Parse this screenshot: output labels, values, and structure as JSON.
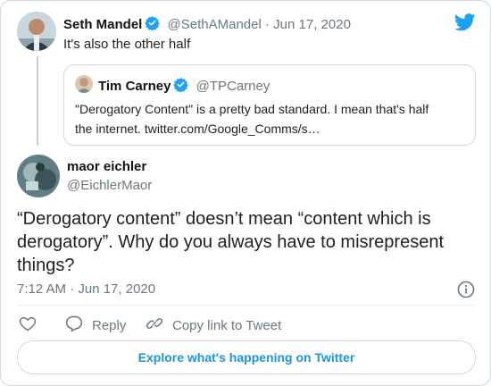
{
  "parent_tweet": {
    "author_name": "Seth Mandel",
    "author_handle": "@SethAMandel",
    "separator": "·",
    "date": "Jun 17, 2020",
    "text": "It's also the other half"
  },
  "quoted_tweet": {
    "author_name": "Tim Carney",
    "author_handle": "@TPCarney",
    "text_line1": "\"Derogatory Content\" is a pretty bad standard. I mean that's half",
    "text_line2": "the internet. twitter.com/Google_Comms/s…"
  },
  "main_tweet": {
    "author_name": "maor eichler",
    "author_handle": "@EichlerMaor",
    "text": "“Derogatory content” doesn’t mean “content which is derogatory”. Why do you always have to misrepresent things?",
    "time": "7:12 AM · Jun 17, 2020"
  },
  "actions": {
    "reply_label": "Reply",
    "copy_link_label": "Copy link to Tweet"
  },
  "explore_label": "Explore what's happening on Twitter",
  "colors": {
    "twitter_blue": "#1da1f2",
    "link_blue": "#1b95e0",
    "muted": "#697882"
  },
  "icons": [
    "twitter-bird-icon",
    "verified-badge-icon",
    "info-icon",
    "heart-icon",
    "reply-icon",
    "link-icon"
  ]
}
